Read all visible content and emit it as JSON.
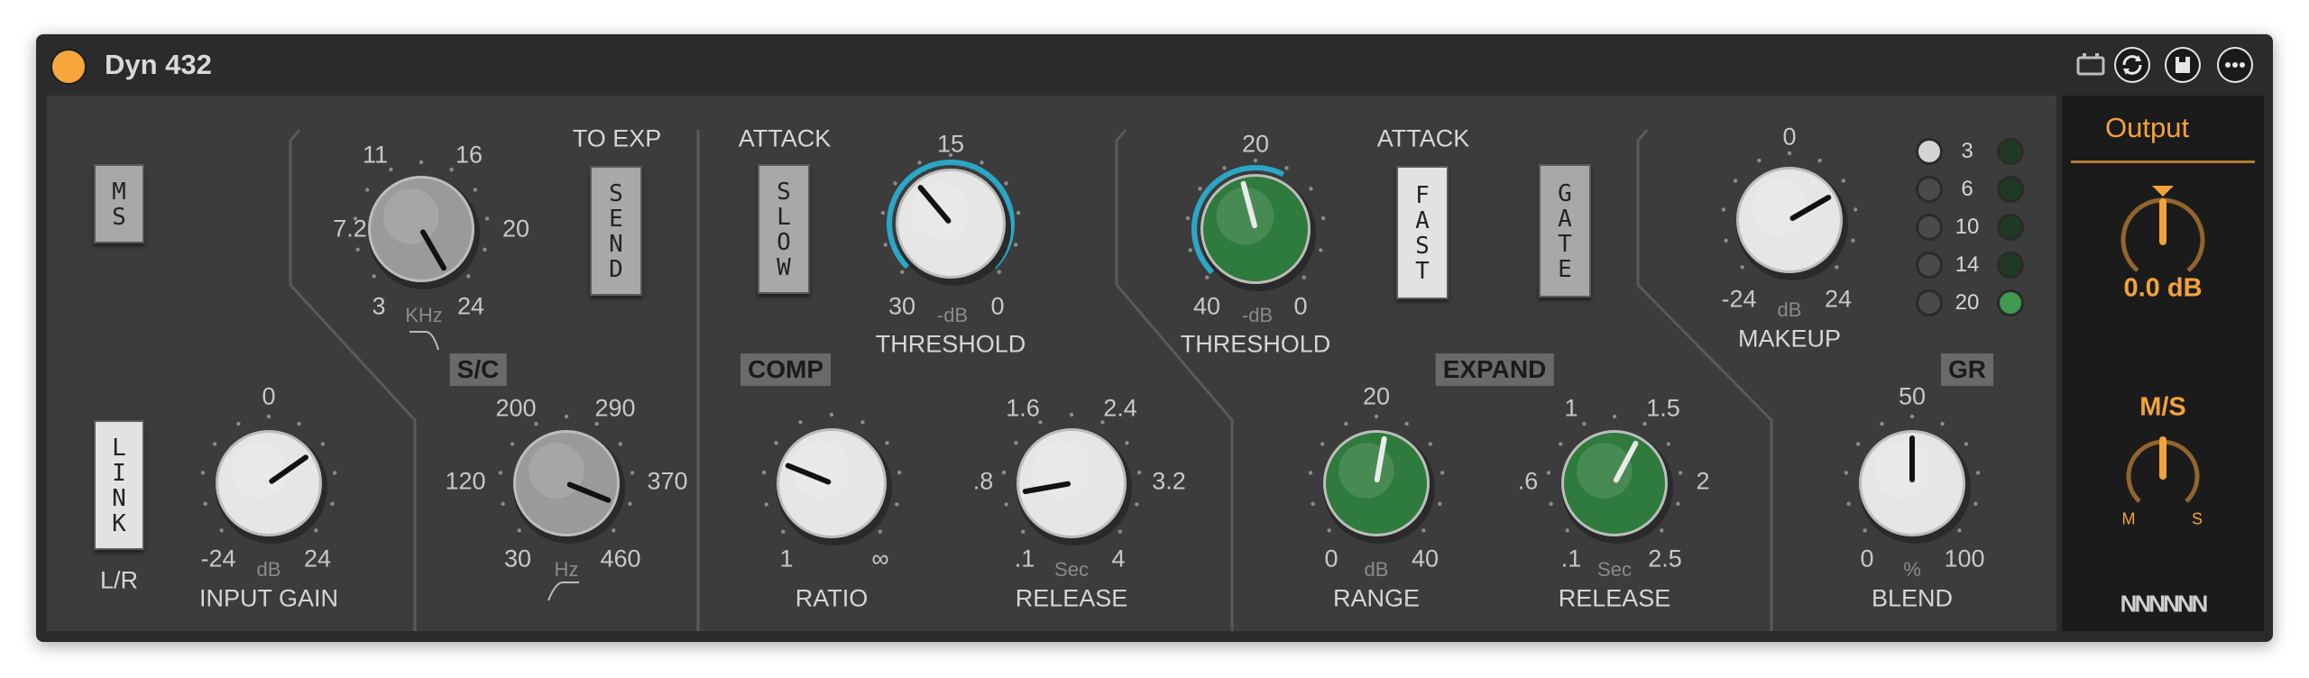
{
  "device": {
    "title": "Dyn 432"
  },
  "titlebar_icons": [
    "battery-icon",
    "sync-icon",
    "save-icon",
    "more-icon"
  ],
  "buttons": {
    "ms": "MS",
    "link": "LINK",
    "send": "SEND",
    "slow": "SLOW",
    "fast": "FAST",
    "gate": "GATE",
    "ms_active": false,
    "link_active": true,
    "send_active": false,
    "slow_active": false,
    "fast_active": true,
    "gate_active": false
  },
  "labels": {
    "lr": "L/R",
    "to_exp": "TO EXP",
    "sc": "S/C",
    "comp": "COMP",
    "expand": "EXPAND",
    "attack_comp": "ATTACK",
    "attack_exp": "ATTACK",
    "gr": "GR"
  },
  "sc_freq": {
    "min": "3",
    "t1": "7.2",
    "t2": "11",
    "t3": "16",
    "t4": "20",
    "max": "24",
    "unit": "KHz"
  },
  "sc_hp": {
    "min": "30",
    "t1": "120",
    "t2": "200",
    "t3": "290",
    "t4": "370",
    "max": "460",
    "unit": "Hz"
  },
  "input_gain": {
    "label": "INPUT GAIN",
    "top": "0",
    "min": "-24",
    "max": "24",
    "unit": "dB"
  },
  "comp_threshold": {
    "label": "THRESHOLD",
    "top": "15",
    "min": "30",
    "max": "0",
    "unit": "-dB"
  },
  "ratio": {
    "label": "RATIO",
    "min": "1",
    "max": "∞"
  },
  "comp_release": {
    "label": "RELEASE",
    "t1": "1.6",
    "t2": "2.4",
    "left": ".8",
    "right": "3.2",
    "min": ".1",
    "max": "4",
    "unit": "Sec"
  },
  "exp_threshold": {
    "label": "THRESHOLD",
    "top": "20",
    "min": "40",
    "max": "0",
    "unit": "-dB"
  },
  "range": {
    "label": "RANGE",
    "top": "20",
    "min": "0",
    "max": "40",
    "unit": "dB"
  },
  "exp_release": {
    "label": "RELEASE",
    "t1": "1",
    "t2": "1.5",
    "left": ".6",
    "right": "2",
    "min": ".1",
    "max": "2.5",
    "unit": "Sec"
  },
  "makeup": {
    "label": "MAKEUP",
    "top": "0",
    "min": "-24",
    "max": "24",
    "unit": "dB"
  },
  "blend": {
    "label": "BLEND",
    "top": "50",
    "min": "0",
    "max": "100",
    "unit": "%"
  },
  "gr_meter": {
    "levels": [
      "3",
      "6",
      "10",
      "14",
      "20"
    ]
  },
  "output": {
    "title": "Output",
    "gain_value": "0.0 dB",
    "ms_label": "M/S",
    "m": "M",
    "s": "S",
    "logo": "NNNNNN"
  },
  "colors": {
    "accent_orange": "#f3a33a",
    "teal_ring": "#2aa7c7",
    "green_knob": "#2f7a3d",
    "panel": "#3c3c3c"
  }
}
